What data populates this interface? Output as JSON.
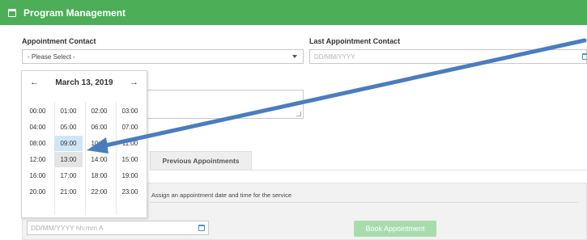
{
  "header": {
    "title": "Program Management",
    "icon": "calendar-icon",
    "color": "#4cae57"
  },
  "form": {
    "appointment_contact_label": "Appointment Contact",
    "appointment_contact_value": "- Please Select -",
    "last_contact_label": "Last Appointment Contact",
    "last_contact_placeholder": "DD/MM/YYYY"
  },
  "picker": {
    "month_label": "March 13, 2019",
    "prev": "←",
    "next": "→",
    "hours": [
      "00:00",
      "01:00",
      "02:00",
      "03:00",
      "04:00",
      "05:00",
      "06:00",
      "07:00",
      "08:00",
      "09:00",
      "10:00",
      "11:00",
      "12:00",
      "13:00",
      "14:00",
      "15:00",
      "16:00",
      "17:00",
      "18:00",
      "19:00",
      "20:00",
      "21:00",
      "22:00",
      "23:00"
    ],
    "selected_hour": "09:00",
    "hover_hour": "13:00"
  },
  "tabs": {
    "previous": "Previous Appointments"
  },
  "panel": {
    "assign_text": "Assign an appointment date and time for the service",
    "datetime_placeholder": "DD/MM/YYYY hh:mm A",
    "book_label": "Book Appointment"
  },
  "annotation": {
    "color": "#4a7dbf"
  }
}
